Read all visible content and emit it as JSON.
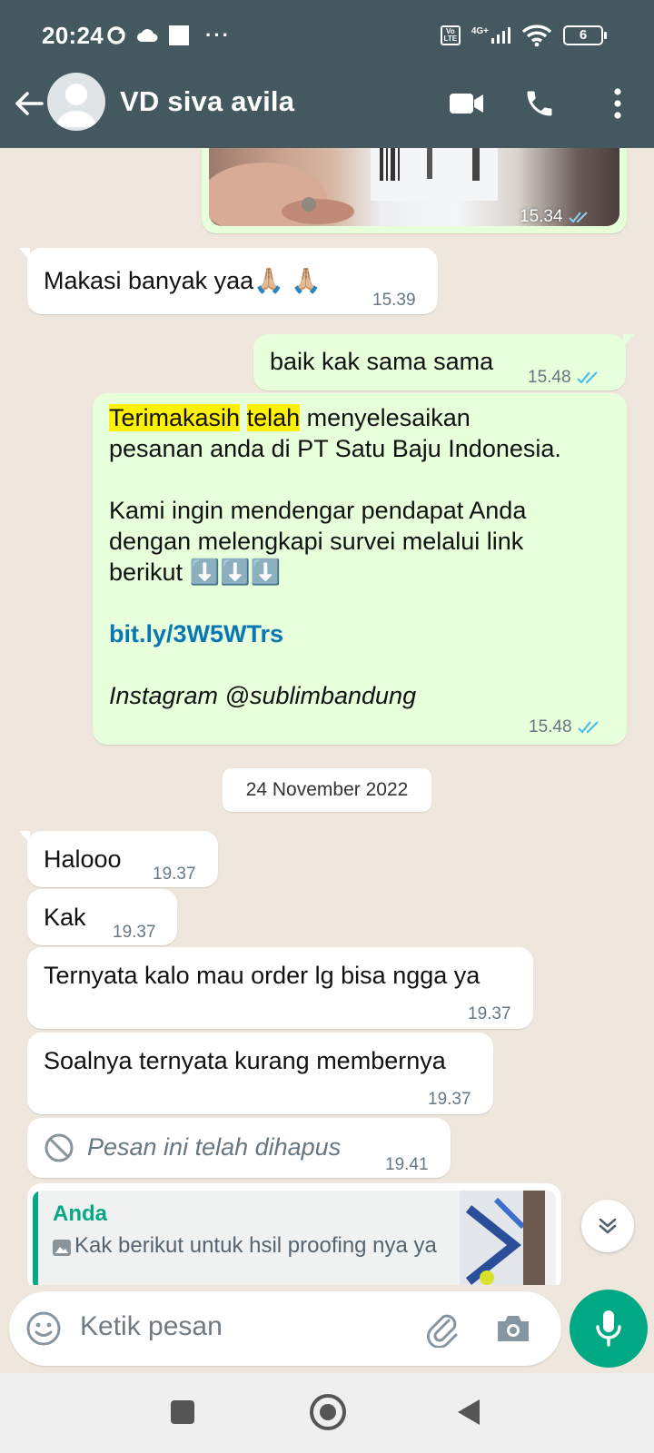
{
  "status_bar": {
    "time": "20:24",
    "volte_label": "Vo LTE",
    "network": "4G+",
    "battery": "6"
  },
  "header": {
    "contact_name": "VD siva avila"
  },
  "messages": {
    "photo_time": "15.34",
    "thanks": {
      "text": "Makasi banyak yaa🙏🏼 🙏🏼",
      "time": "15.39"
    },
    "reply": {
      "text": "baik kak sama sama",
      "time": "15.48"
    },
    "survey": {
      "hl1": "Terimakasih",
      "hl2": "telah",
      "line1_rest": "menyelesaikan",
      "line2": "pesanan anda di PT Satu Baju Indonesia.",
      "para2": "Kami ingin mendengar pendapat Anda dengan melengkapi survei melalui link berikut ⬇️⬇️⬇️",
      "link": "bit.ly/3W5WTrs",
      "instagram": "Instagram @sublimbandung",
      "time": "15.48"
    },
    "date_divider": "24 November 2022",
    "halo": {
      "text": "Halooo",
      "time": "19.37"
    },
    "kak": {
      "text": "Kak",
      "time": "19.37"
    },
    "order": {
      "text": "Ternyata kalo mau order lg bisa ngga ya",
      "time": "19.37"
    },
    "member": {
      "text": "Soalnya ternyata kurang membernya",
      "time": "19.37"
    },
    "deleted": {
      "text": "Pesan ini telah dihapus",
      "time": "19.41"
    },
    "quoted": {
      "author": "Anda",
      "text": "Kak berikut untuk hsil proofing nya ya"
    }
  },
  "composer": {
    "placeholder": "Ketik pesan"
  },
  "colors": {
    "header": "#43585f",
    "chat_bg": "#efe7dd",
    "outgoing": "#e7ffdb",
    "incoming": "#ffffff",
    "accent": "#00a884",
    "read_ticks": "#53bdeb",
    "link": "#0a77b3"
  },
  "icons": [
    "back-arrow-icon",
    "video-call-icon",
    "phone-icon",
    "more-vertical-icon",
    "emoji-icon",
    "attach-icon",
    "camera-icon",
    "mic-icon",
    "blocked-icon",
    "double-check-icon",
    "chevron-double-down-icon",
    "image-icon"
  ]
}
